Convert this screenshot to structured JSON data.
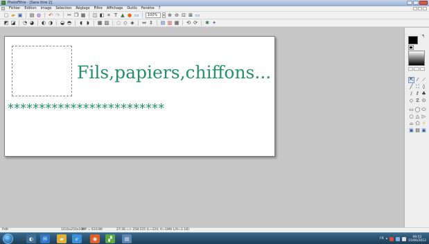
{
  "window": {
    "title": "PhotoFiltre - [Sans titre 2]"
  },
  "menu": {
    "items": [
      "Fichier",
      "Edition",
      "Image",
      "Sélection",
      "Réglage",
      "Filtre",
      "Affichage",
      "Outils",
      "Fenêtre",
      "?"
    ]
  },
  "toolbar": {
    "zoom_value": "100%"
  },
  "canvas": {
    "headline": "Fils,papiers,chiffons...",
    "stars": "*************************"
  },
  "status": {
    "ready": "Prêt",
    "image_size": "1010x250x16M",
    "coords": "X:Y = 633:86",
    "selection_info": "27:36 => 258:225 (L=224, H=189) L/H=1.18)"
  },
  "taskbar": {
    "lang": "FR",
    "time": "09:52",
    "date": "15/06/2012"
  },
  "colors": {
    "accent_text": "#22906a",
    "taskbar": "#2b5373"
  }
}
